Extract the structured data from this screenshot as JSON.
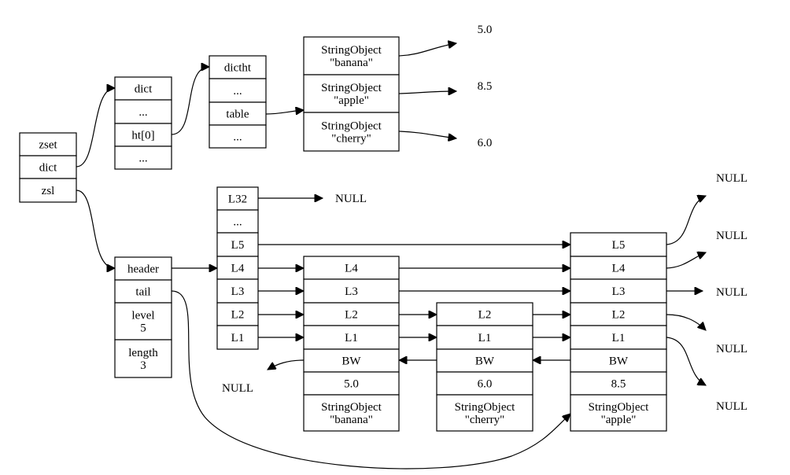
{
  "nodes": {
    "zset": [
      "zset",
      "dict",
      "zsl"
    ],
    "dict": [
      "dict",
      "...",
      "ht[0]",
      "..."
    ],
    "dictht": [
      "dictht",
      "...",
      "table",
      "..."
    ],
    "dict_entries": [
      "StringObject\n\"banana\"",
      "StringObject\n\"apple\"",
      "StringObject\n\"cherry\""
    ],
    "zskiplist": [
      "header",
      "tail",
      "level\n5",
      "length\n3"
    ],
    "header_levels": [
      "L32",
      "...",
      "L5",
      "L4",
      "L3",
      "L2",
      "L1"
    ],
    "node_banana": [
      "L4",
      "L3",
      "L2",
      "L1",
      "BW",
      "5.0",
      "StringObject\n\"banana\""
    ],
    "node_cherry": [
      "L2",
      "L1",
      "BW",
      "6.0",
      "StringObject\n\"cherry\""
    ],
    "node_apple": [
      "L5",
      "L4",
      "L3",
      "L2",
      "L1",
      "BW",
      "8.5",
      "StringObject\n\"apple\""
    ]
  },
  "labels": {
    "score_banana": "5.0",
    "score_apple": "8.5",
    "score_cherry": "6.0",
    "null": "NULL"
  }
}
